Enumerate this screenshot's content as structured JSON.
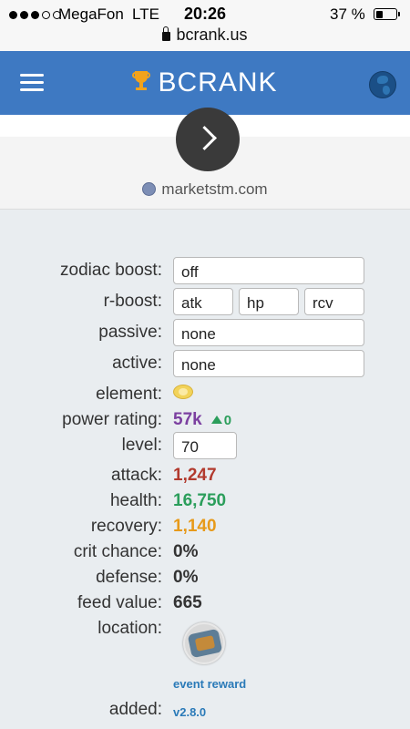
{
  "status_bar": {
    "carrier": "MegaFon",
    "network": "LTE",
    "time": "20:26",
    "battery_percent": "37 %",
    "battery_level": 0.37,
    "url": "bcrank.us"
  },
  "nav": {
    "brand": "BCRANK"
  },
  "source_link": "marketstm.com",
  "stats": {
    "zodiac_boost": {
      "label": "zodiac boost:",
      "value": "off"
    },
    "r_boost": {
      "label": "r-boost:",
      "atk": "atk",
      "hp": "hp",
      "rcv": "rcv"
    },
    "passive": {
      "label": "passive:",
      "value": "none"
    },
    "active": {
      "label": "active:",
      "value": "none"
    },
    "element": {
      "label": "element:",
      "icon": "element-icon"
    },
    "power_rating": {
      "label": "power rating:",
      "value": "57k",
      "delta": "0"
    },
    "level": {
      "label": "level:",
      "value": "70"
    },
    "attack": {
      "label": "attack:",
      "value": "1,247"
    },
    "health": {
      "label": "health:",
      "value": "16,750"
    },
    "recovery": {
      "label": "recovery:",
      "value": "1,140"
    },
    "crit_chance": {
      "label": "crit chance:",
      "value": "0%"
    },
    "defense": {
      "label": "defense:",
      "value": "0%"
    },
    "feed_value": {
      "label": "feed value:",
      "value": "665"
    },
    "location": {
      "label": "location:",
      "caption": "event reward"
    },
    "added": {
      "label": "added:",
      "value": "v2.8.0"
    }
  },
  "colors": {
    "nav_bg": "#3e79c2",
    "attack": "#b23a2e",
    "health": "#2b9e5b",
    "recovery": "#e79a1a",
    "power": "#7b3fa0",
    "link": "#2a7ab8"
  }
}
